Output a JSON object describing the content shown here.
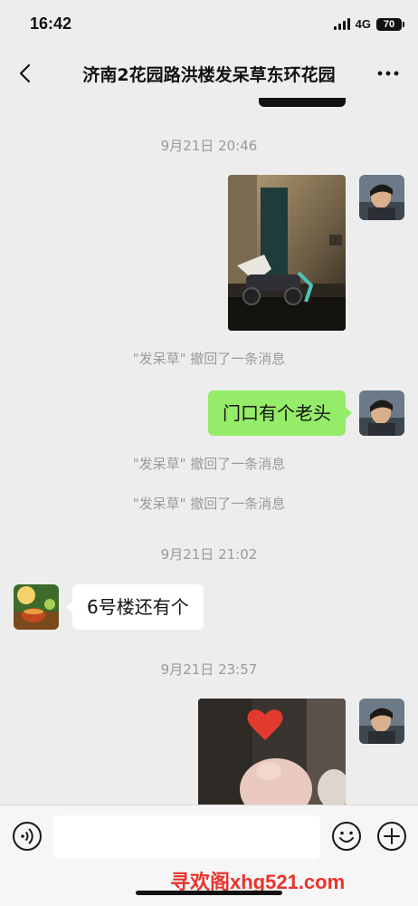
{
  "status_bar": {
    "time": "16:42",
    "network": "4G",
    "battery": "70"
  },
  "nav": {
    "title": "济南2花园路洪楼发呆草东环花园",
    "back_icon": "chevron-left-icon",
    "more_icon": "more-dots-icon"
  },
  "chat": {
    "timestamps": [
      "9月21日 20:46",
      "9月21日 21:02",
      "9月21日 23:57"
    ],
    "recall_notices": [
      "\"发呆草\" 撤回了一条消息",
      "\"发呆草\" 撤回了一条消息",
      "\"发呆草\" 撤回了一条消息"
    ],
    "messages": [
      {
        "side": "right",
        "type": "image",
        "description_icon": "photo-scooter"
      },
      {
        "side": "right",
        "type": "text",
        "text": "门口有个老头"
      },
      {
        "side": "left",
        "type": "text",
        "text": "6号楼还有个"
      },
      {
        "side": "right",
        "type": "image",
        "description_icon": "photo-heart-hand"
      }
    ]
  },
  "input_bar": {
    "value": "",
    "voice_icon": "voice-icon",
    "emoji_icon": "emoji-icon",
    "plus_icon": "plus-icon"
  },
  "watermark": "寻欢阁xhg521.com",
  "colors": {
    "background": "#ededed",
    "bubble_self": "#95ec69",
    "bubble_other": "#ffffff",
    "meta_text": "#9a9a9a",
    "watermark": "#e8332c"
  }
}
